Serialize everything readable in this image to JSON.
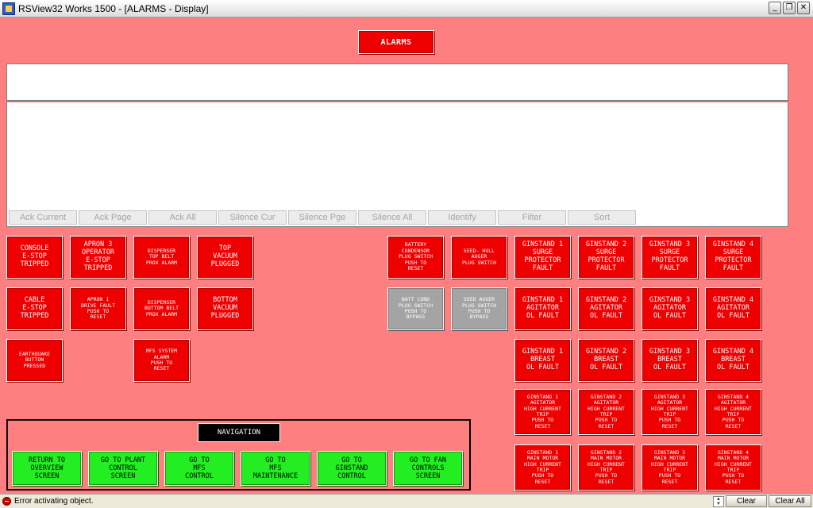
{
  "window": {
    "title": "RSView32 Works 1500 - [ALARMS - Display]",
    "min_glyph": "_",
    "restore_glyph": "❐",
    "close_glyph": "✕"
  },
  "display": {
    "title": "ALARMS"
  },
  "toolbar": {
    "buttons": [
      "Ack Current",
      "Ack Page",
      "Ack All",
      "Silence Cur",
      "Silence Pge",
      "Silence All",
      "Identify",
      "Filter",
      "Sort"
    ]
  },
  "alarms": {
    "console_estop": "CONSOLE\nE-STOP\nTRIPPED",
    "apron3_estop": "APRON 3\nOPERATOR\nE-STOP\nTRIPPED",
    "disperser_top": "DISPERSER\nTOP BELT\nPROX ALARM",
    "top_vacuum": "TOP\nVACUUM\nPLUGGED",
    "cable_estop": "CABLE\nE-STOP\nTRIPPED",
    "apron1_drive": "APRON 1\nDRIVE FAULT\nPUSH TO\nRESET",
    "disperser_bottom": "DISPERSER\nBOTTOM BELT\nPROX ALARM",
    "bottom_vacuum": "BOTTOM\nVACUUM\nPLUGGED",
    "earthquake": "EARTHQUAKE\nBUTTON\nPRESSED",
    "mfs_system": "MFS SYSTEM\nALARM\nPUSH TO\nRESET",
    "battery_condensor": "BATTERY\nCONDENSOR\nPLUG SWITCH\nPUSH TO\nRESET",
    "seed_hull_auger": "SEED- HULL\nAUGER\nPLUG SWITCH",
    "batt_cond_bypass": "BATT COND\nPLUG SWITCH\nPUSH TO\nBYPASS",
    "seed_auger_bypass": "SEED AUGER\nPLUG SWITCH\nPUSH TO\nBYPASS",
    "gs1_surge": "GINSTAND 1\nSURGE\nPROTECTOR\nFAULT",
    "gs2_surge": "GINSTAND 2\nSURGE\nPROTECTOR\nFAULT",
    "gs3_surge": "GINSTAND 3\nSURGE\nPROTECTOR\nFAULT",
    "gs4_surge": "GINSTAND 4\nSURGE\nPROTECTOR\nFAULT",
    "gs1_agitator_ol": "GINSTAND 1\nAGITATOR\nOL FAULT",
    "gs2_agitator_ol": "GINSTAND 2\nAGITATOR\nOL FAULT",
    "gs3_agitator_ol": "GINSTAND 3\nAGITATOR\nOL FAULT",
    "gs4_agitator_ol": "GINSTAND 4\nAGITATOR\nOL FAULT",
    "gs1_breast_ol": "GINSTAND 1\nBREAST\nOL FAULT",
    "gs2_breast_ol": "GINSTAND 2\nBREAST\nOL FAULT",
    "gs3_breast_ol": "GINSTAND 3\nBREAST\nOL FAULT",
    "gs4_breast_ol": "GINSTAND 4\nBREAST\nOL FAULT",
    "gs1_agitator_hc": "GINSTAND 1\nAGITATOR\nHIGH CURRENT\nTRIP\nPUSH TO\nRESET",
    "gs2_agitator_hc": "GINSTAND 2\nAGITATOR\nHIGH CURRENT\nTRIP\nPUSH TO\nRESET",
    "gs3_agitator_hc": "GINSTAND 3\nAGITATOR\nHIGH CURRENT\nTRIP\nPUSH TO\nRESET",
    "gs4_agitator_hc": "GINSTAND 4\nAGITATOR\nHIGH CURRENT\nTRIP\nPUSH TO\nRESET",
    "gs1_main_motor_hc": "GINSTAND 1\nMAIN MOTOR\nHIGH CURRENT\nTRIP\nPUSH TO\nRESET",
    "gs2_main_motor_hc": "GINSTAND 2\nMAIN MOTOR\nHIGH CURRENT\nTRIP\nPUSH TO\nRESET",
    "gs3_main_motor_hc": "GINSTAND 3\nMAIN MOTOR\nHIGH CURRENT\nTRIP\nPUSH TO\nRESET",
    "gs4_main_motor_hc": "GINSTAND 4\nMAIN MOTOR\nHIGH CURRENT\nTRIP\nPUSH TO\nRESET"
  },
  "navigation": {
    "title": "NAVIGATION",
    "buttons": [
      "RETURN TO\nOVERVIEW\nSCREEN",
      "GO TO PLANT\nCONTROL\nSCREEN",
      "GO TO\nMFS\nCONTROL",
      "GO TO\nMFS\nMAINTENANCE",
      "GO TO\nGINSTAND\nCONTROL",
      "GO TO FAN\nCONTROLS\nSCREEN"
    ]
  },
  "status": {
    "message": "Error activating object.",
    "clear_label": "Clear",
    "clear_all_label": "Clear All"
  },
  "colors": {
    "background": "#fd7f7f",
    "alarm_red": "#ee0000",
    "bypass_gray": "#a4a4a4",
    "nav_green": "#22ee22"
  }
}
